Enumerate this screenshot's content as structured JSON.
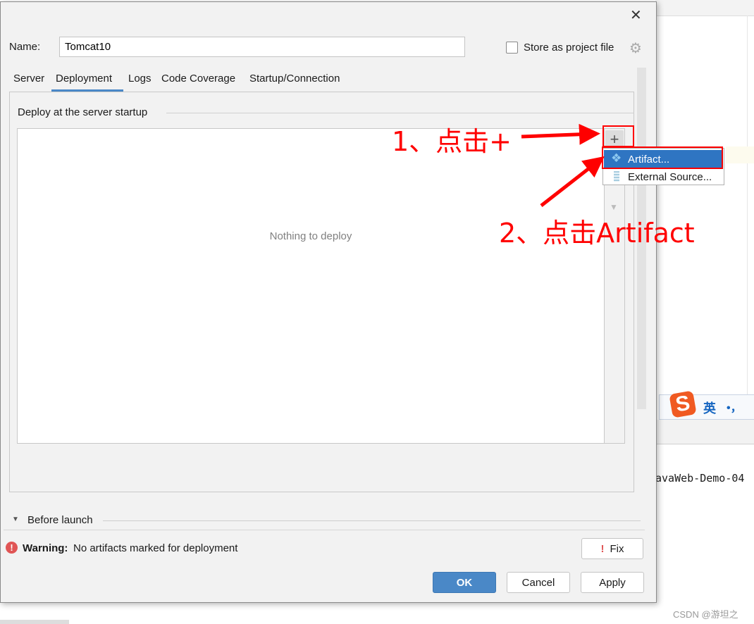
{
  "dialog": {
    "close_icon": "close-icon",
    "name_label": "Name:",
    "name_value": "Tomcat10",
    "store_label": "Store as project file",
    "store_checked": false,
    "tabs": [
      {
        "label": "Server"
      },
      {
        "label": "Deployment",
        "active": true
      },
      {
        "label": "Logs"
      },
      {
        "label": "Code Coverage"
      },
      {
        "label": "Startup/Connection"
      }
    ],
    "deploy_section": "Deploy at the server startup",
    "empty_text": "Nothing to deploy",
    "add_menu": [
      {
        "label": "Artifact...",
        "selected": true
      },
      {
        "label": "External Source..."
      }
    ],
    "before_launch": "Before launch",
    "warning_bold": "Warning:",
    "warning_text": "No artifacts marked for deployment",
    "fix_label": "Fix",
    "ok_label": "OK",
    "cancel_label": "Cancel",
    "apply_label": "Apply"
  },
  "annotations": {
    "step1": "1、点击+",
    "step2": "2、点击Artifact",
    "color": "#ff0000"
  },
  "background": {
    "ime_lang": "英",
    "ime_punct": "•，",
    "project_text": "avaWeb-Demo-04",
    "watermark": "CSDN @游坦之"
  },
  "colors": {
    "accent": "#4a88c7",
    "selection": "#2f75c2"
  }
}
